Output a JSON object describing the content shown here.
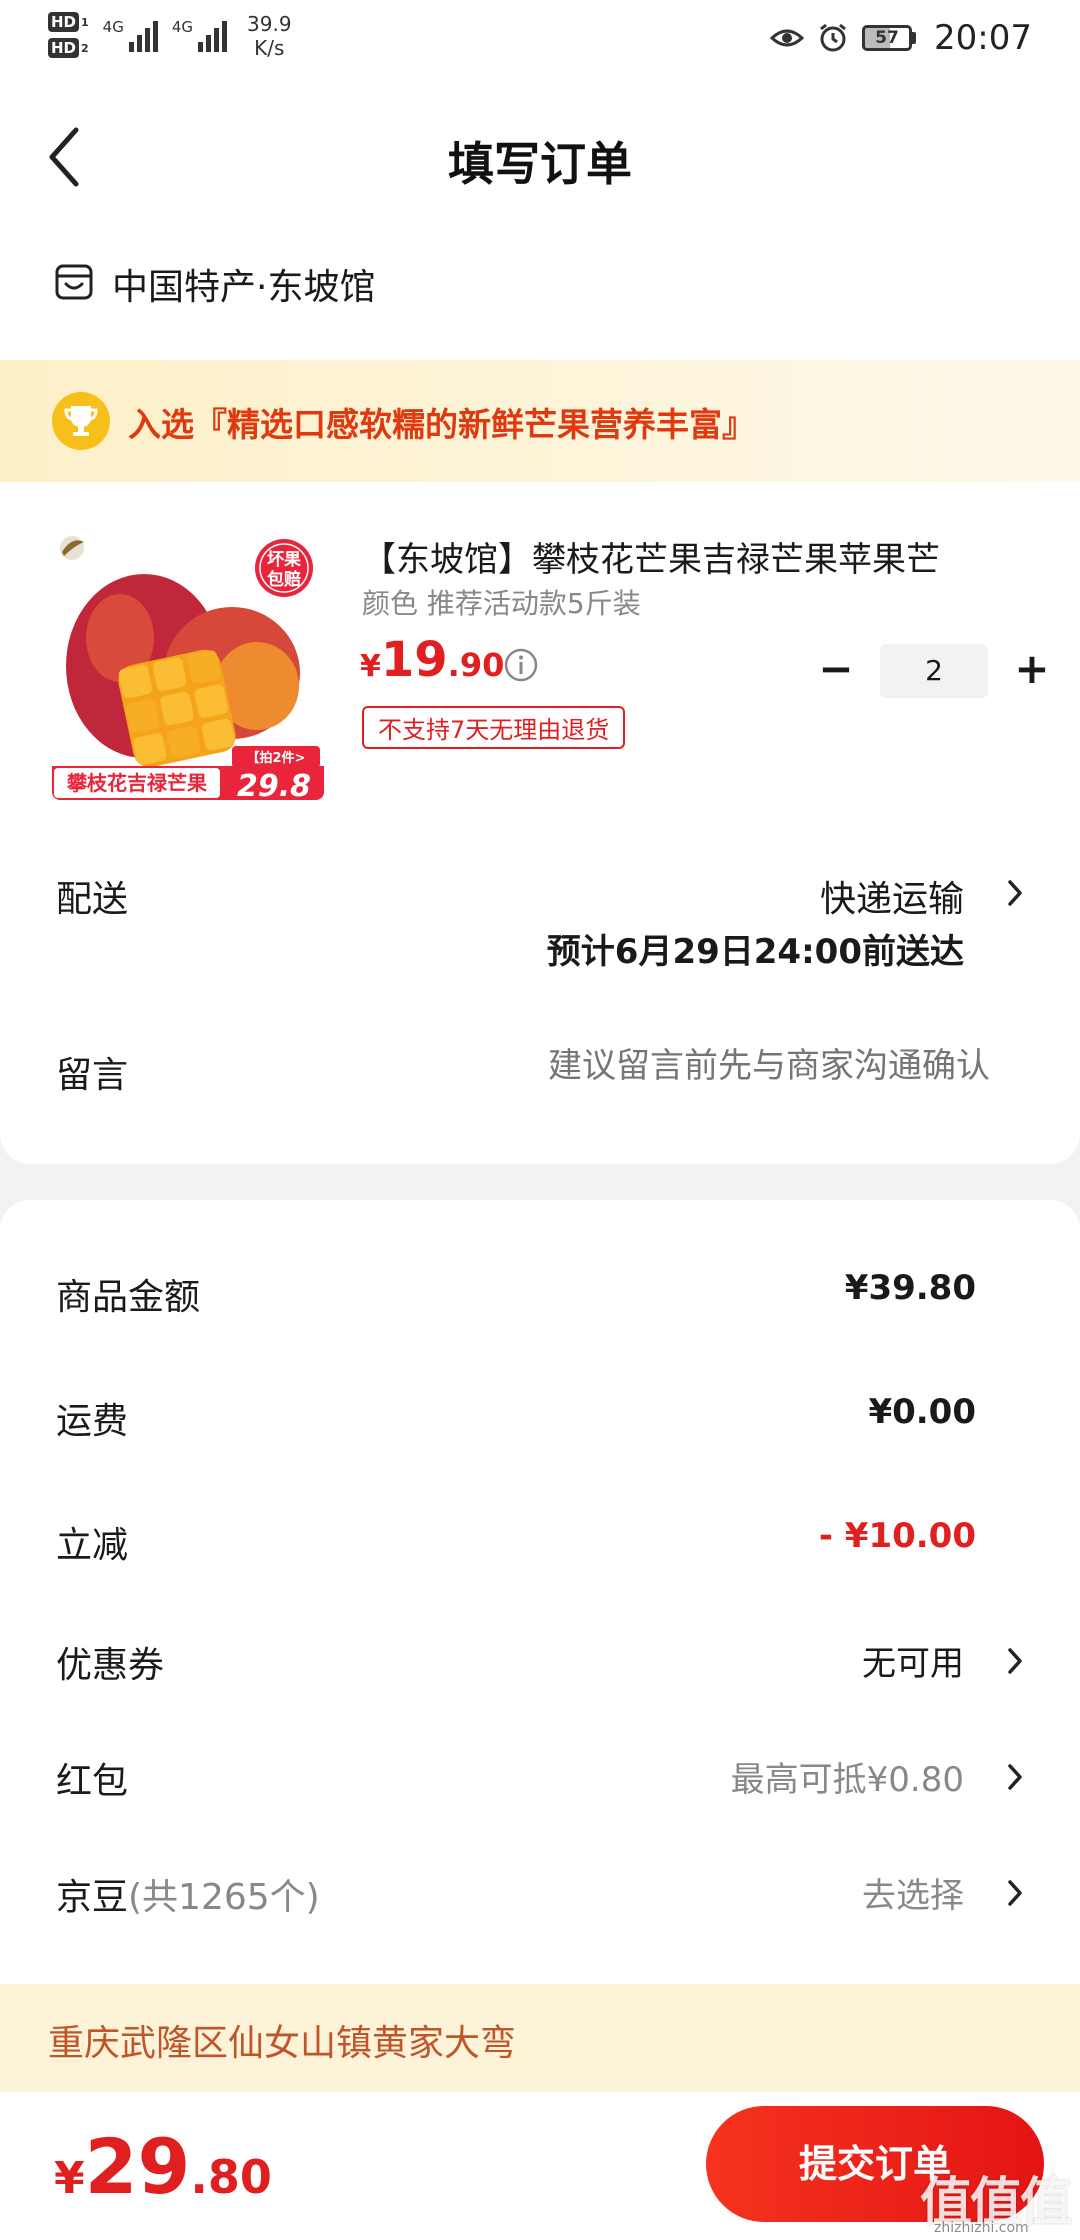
{
  "status_bar": {
    "sim1": "HD",
    "sim1_sub": "1",
    "sim2": "HD",
    "sim2_sub": "2",
    "net1": "4G",
    "net2": "4G",
    "speed_value": "39.9",
    "speed_unit": "K/s",
    "battery": "57",
    "time": "20:07"
  },
  "header": {
    "title": "填写订单"
  },
  "shop": {
    "name": "中国特产·东坡馆"
  },
  "banner": {
    "text": "入选『精选口感软糯的新鲜芒果营养丰富』"
  },
  "product": {
    "title": "【东坡馆】攀枝花芒果吉禄芒果苹果芒",
    "spec": "颜色 推荐活动款5斤装",
    "price_currency": "¥",
    "price_int": "19",
    "price_dec": ".90",
    "badge": "不支持7天无理由退货",
    "quantity": "2",
    "image": {
      "stamp": "坏果包赔",
      "promo_tag": "【拍2件>",
      "promo_price": "29.8",
      "caption": "攀枝花吉禄芒果"
    }
  },
  "delivery": {
    "label": "配送",
    "method": "快递运输",
    "eta": "预计6月29日24:00前送达"
  },
  "message": {
    "label": "留言",
    "placeholder": "建议留言前先与商家沟通确认"
  },
  "summary": {
    "goods_label": "商品金额",
    "goods_value": "¥39.80",
    "shipping_label": "运费",
    "shipping_value": "¥0.00",
    "discount_label": "立减",
    "discount_value": "- ¥10.00",
    "coupon_label": "优惠券",
    "coupon_value": "无可用",
    "redpacket_label": "红包",
    "redpacket_value": "最高可抵¥0.80",
    "beans_label": "京豆",
    "beans_count": "(共1265个)",
    "beans_value": "去选择"
  },
  "address": {
    "text": "重庆武隆区仙女山镇黄家大弯"
  },
  "footer": {
    "total_currency": "¥",
    "total_int": "29",
    "total_dec": ".80",
    "submit_label": "提交订单",
    "watermark": "值值值",
    "watermark_sub": "zhizhizhi.com"
  },
  "colors": {
    "accent_red": "#e02020",
    "banner_bg": "#fdf0c8",
    "address_bg": "#fdf3d8"
  }
}
